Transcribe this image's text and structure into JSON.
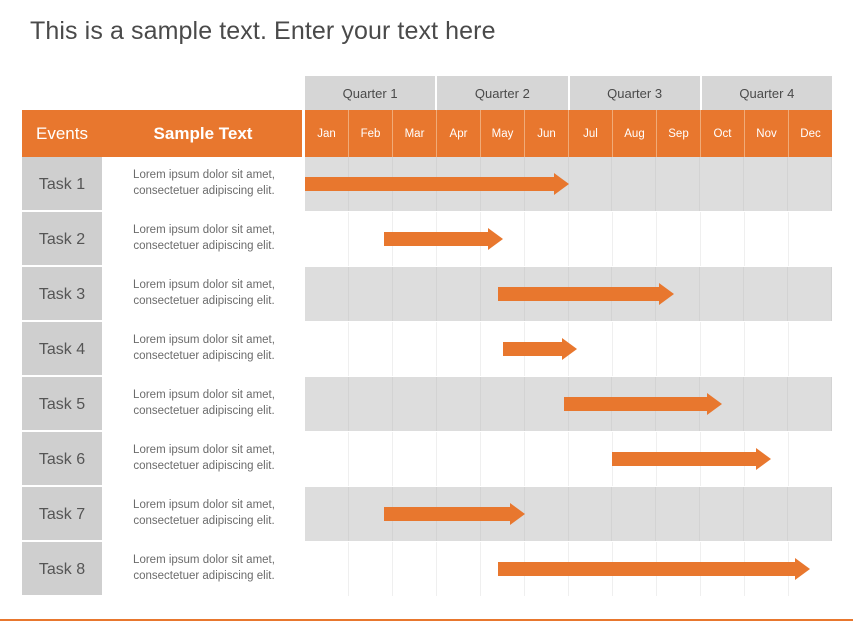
{
  "title": "This is a sample text. Enter your text here",
  "colors": {
    "accent": "#e8772e",
    "header_gray": "#d6d6d6",
    "row_gray": "#dddddd",
    "label_gray": "#cfcfcf",
    "text_gray": "#4a4a4a"
  },
  "table": {
    "events_header": "Events",
    "sample_header": "Sample Text",
    "quarters": [
      "Quarter 1",
      "Quarter 2",
      "Quarter 3",
      "Quarter 4"
    ],
    "months": [
      "Jan",
      "Feb",
      "Mar",
      "Apr",
      "May",
      "Jun",
      "Jul",
      "Aug",
      "Sep",
      "Oct",
      "Nov",
      "Dec"
    ],
    "description": "Lorem ipsum dolor sit amet, consectetuer adipiscing elit."
  },
  "chart_data": {
    "type": "bar",
    "title": "This is a sample text. Enter your text here",
    "xlabel": "",
    "ylabel": "",
    "categories": [
      "Task 1",
      "Task 2",
      "Task 3",
      "Task 4",
      "Task 5",
      "Task 6",
      "Task 7",
      "Task 8"
    ],
    "x_ticks": [
      "Jan",
      "Feb",
      "Mar",
      "Apr",
      "May",
      "Jun",
      "Jul",
      "Aug",
      "Sep",
      "Oct",
      "Nov",
      "Dec"
    ],
    "groups": [
      "Quarter 1",
      "Quarter 2",
      "Quarter 3",
      "Quarter 4"
    ],
    "tasks": [
      {
        "name": "Task 1",
        "desc": "Lorem ipsum dolor sit amet, consectetuer adipiscing elit.",
        "start_month": 1,
        "end_month": 7
      },
      {
        "name": "Task 2",
        "desc": "Lorem ipsum dolor sit amet, consectetuer adipiscing elit.",
        "start_month": 2.8,
        "end_month": 5.5
      },
      {
        "name": "Task 3",
        "desc": "Lorem ipsum dolor sit amet, consectetuer adipiscing elit.",
        "start_month": 5.4,
        "end_month": 9.4
      },
      {
        "name": "Task 4",
        "desc": "Lorem ipsum dolor sit amet, consectetuer adipiscing elit.",
        "start_month": 5.5,
        "end_month": 7.2
      },
      {
        "name": "Task 5",
        "desc": "Lorem ipsum dolor sit amet, consectetuer adipiscing elit.",
        "start_month": 6.9,
        "end_month": 10.5
      },
      {
        "name": "Task 6",
        "desc": "Lorem ipsum dolor sit amet, consectetuer adipiscing elit.",
        "start_month": 8,
        "end_month": 11.6
      },
      {
        "name": "Task 7",
        "desc": "Lorem ipsum dolor sit amet, consectetuer adipiscing elit.",
        "start_month": 2.8,
        "end_month": 6
      },
      {
        "name": "Task 8",
        "desc": "Lorem ipsum dolor sit amet, consectetuer adipiscing elit.",
        "start_month": 5.4,
        "end_month": 12.5
      }
    ],
    "axis_range": [
      1,
      13
    ],
    "grid": true,
    "legend": "none"
  }
}
